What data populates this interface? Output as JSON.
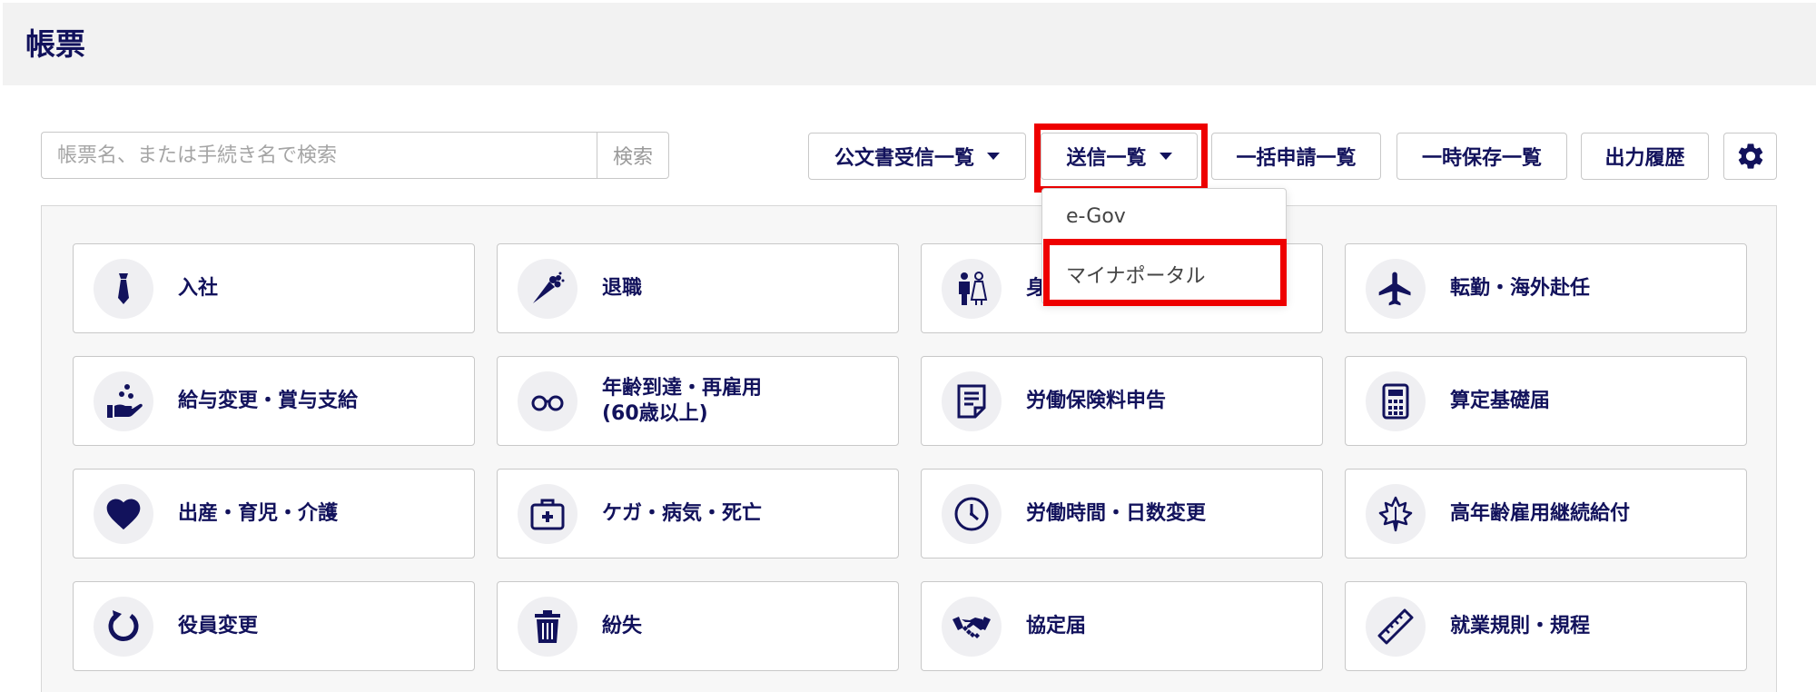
{
  "header": {
    "title": "帳票"
  },
  "search": {
    "placeholder": "帳票名、または手続き名で検索",
    "button": "検索"
  },
  "toolbar": {
    "received_list": "公文書受信一覧",
    "sent_list": "送信一覧",
    "bulk_list": "一括申請一覧",
    "temp_save_list": "一時保存一覧",
    "output_history": "出力履歴"
  },
  "dropdown": {
    "items": [
      "e-Gov",
      "マイナポータル"
    ]
  },
  "cards": [
    {
      "label": "入社",
      "icon": "necktie-icon"
    },
    {
      "label": "退職",
      "icon": "bouquet-icon"
    },
    {
      "label": "身",
      "icon": "wedding-couple-icon"
    },
    {
      "label": "転勤・海外赴任",
      "icon": "airplane-icon"
    },
    {
      "label": "給与変更・賞与支給",
      "icon": "hand-coins-icon"
    },
    {
      "label": "年齢到達・再雇用\n(60歳以上)",
      "icon": "glasses-icon"
    },
    {
      "label": "労働保険料申告",
      "icon": "document-icon"
    },
    {
      "label": "算定基礎届",
      "icon": "calculator-icon"
    },
    {
      "label": "出産・育児・介護",
      "icon": "heart-icon"
    },
    {
      "label": "ケガ・病気・死亡",
      "icon": "first-aid-kit-icon"
    },
    {
      "label": "労働時間・日数変更",
      "icon": "clock-icon"
    },
    {
      "label": "高年齢雇用継続給付",
      "icon": "maple-leaf-icon"
    },
    {
      "label": "役員変更",
      "icon": "refresh-icon"
    },
    {
      "label": "紛失",
      "icon": "trash-icon"
    },
    {
      "label": "協定届",
      "icon": "handshake-icon"
    },
    {
      "label": "就業規則・規程",
      "icon": "ruler-icon"
    }
  ],
  "colors": {
    "primary": "#12125c",
    "highlight": "#ee0000",
    "header_bg": "#f2f2f2"
  }
}
